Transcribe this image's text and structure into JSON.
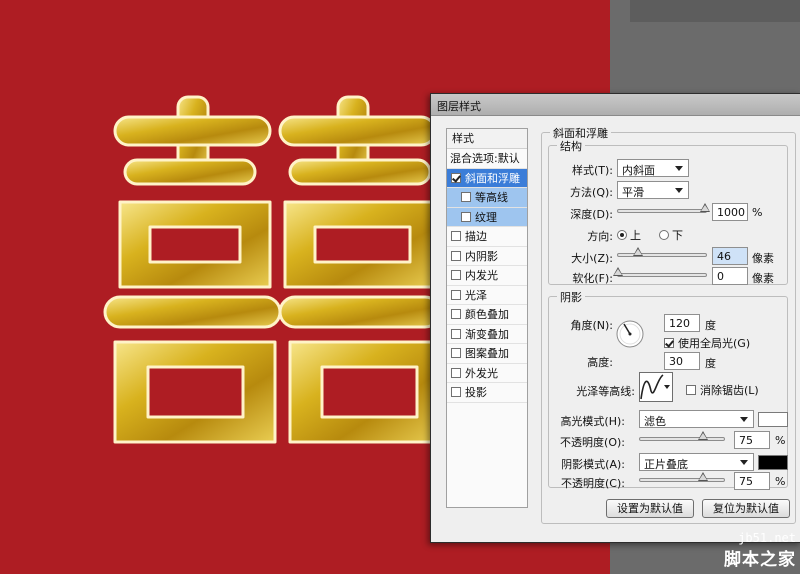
{
  "dialog": {
    "title": "图层样式"
  },
  "styles_panel": {
    "header": "样式",
    "blend_label": "混合选项:默认",
    "items": [
      {
        "label": "斜面和浮雕",
        "checked": true,
        "state": "selected"
      },
      {
        "label": "等高线",
        "checked": false,
        "state": "sub"
      },
      {
        "label": "纹理",
        "checked": false,
        "state": "sub"
      },
      {
        "label": "描边",
        "checked": false,
        "state": "normal"
      },
      {
        "label": "内阴影",
        "checked": false,
        "state": "normal"
      },
      {
        "label": "内发光",
        "checked": false,
        "state": "normal"
      },
      {
        "label": "光泽",
        "checked": false,
        "state": "normal"
      },
      {
        "label": "颜色叠加",
        "checked": false,
        "state": "normal"
      },
      {
        "label": "渐变叠加",
        "checked": false,
        "state": "normal"
      },
      {
        "label": "图案叠加",
        "checked": false,
        "state": "normal"
      },
      {
        "label": "外发光",
        "checked": false,
        "state": "normal"
      },
      {
        "label": "投影",
        "checked": false,
        "state": "normal"
      }
    ]
  },
  "bevel": {
    "section_title": "斜面和浮雕",
    "structure_title": "结构",
    "style_label": "样式(T):",
    "style_value": "内斜面",
    "technique_label": "方法(Q):",
    "technique_value": "平滑",
    "depth_label": "深度(D):",
    "depth_value": "1000",
    "depth_unit": "%",
    "depth_level": 0.99,
    "direction_label": "方向:",
    "direction_up": "上",
    "direction_down": "下",
    "direction_selected": "up",
    "size_label": "大小(Z):",
    "size_value": "46",
    "size_unit": "像素",
    "size_level": 0.23,
    "soften_label": "软化(F):",
    "soften_value": "0",
    "soften_unit": "像素",
    "soften_level": 0.0
  },
  "shading": {
    "title": "阴影",
    "angle_label": "角度(N):",
    "angle_value": "120",
    "angle_unit": "度",
    "global_light_label": "使用全局光(G)",
    "global_light_checked": true,
    "altitude_label": "高度:",
    "altitude_value": "30",
    "altitude_unit": "度",
    "gloss_contour_label": "光泽等高线:",
    "anti_alias_label": "消除锯齿(L)",
    "anti_alias_checked": false,
    "highlight_mode_label": "高光模式(H):",
    "highlight_mode_value": "滤色",
    "highlight_color": "#ffffff",
    "highlight_opacity_label": "不透明度(O):",
    "highlight_opacity_value": "75",
    "highlight_opacity_unit": "%",
    "highlight_opacity_level": 0.75,
    "shadow_mode_label": "阴影模式(A):",
    "shadow_mode_value": "正片叠底",
    "shadow_color": "#000000",
    "shadow_opacity_label": "不透明度(C):",
    "shadow_opacity_value": "75",
    "shadow_opacity_unit": "%",
    "shadow_opacity_level": 0.75
  },
  "buttons": {
    "make_default": "设置为默认值",
    "reset_default": "复位为默认值"
  },
  "watermark": {
    "site": "jb51.net",
    "brand": "脚本之家"
  },
  "colors": {
    "canvas_red": "#ae1d23",
    "gold": "#d8b21e",
    "selection_blue": "#3b7dd8"
  }
}
